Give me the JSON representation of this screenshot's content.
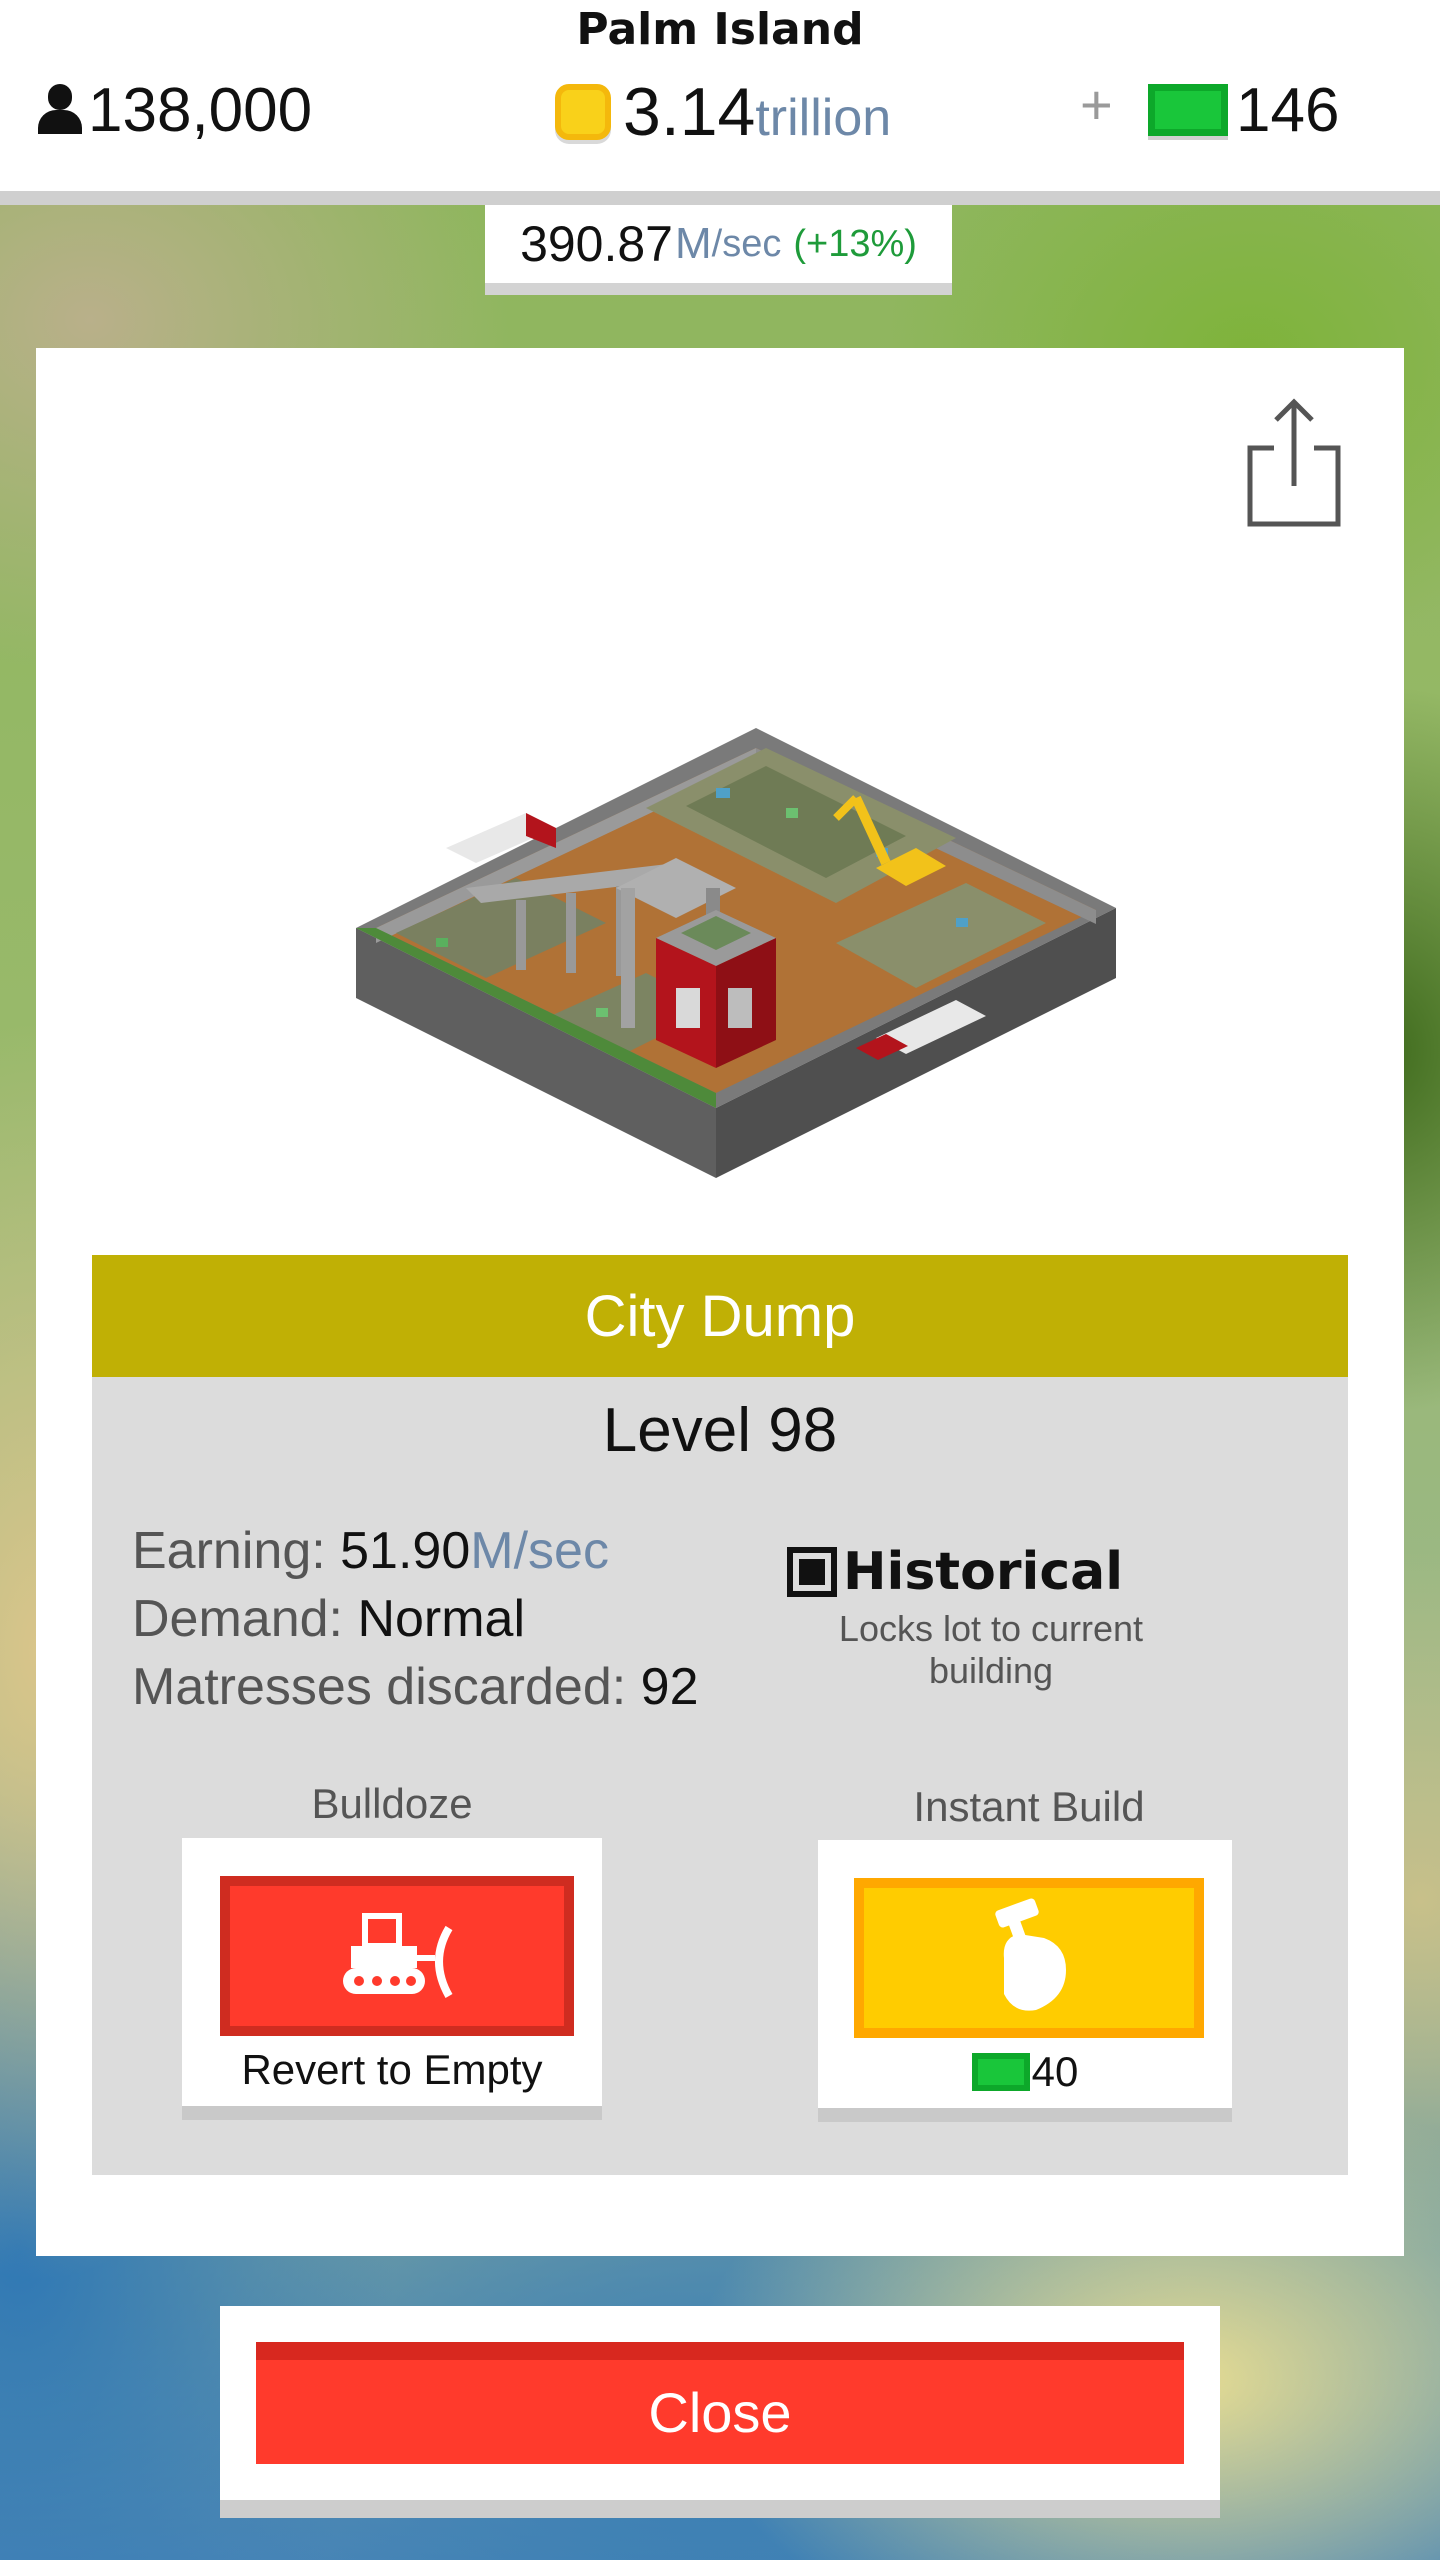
{
  "hud": {
    "island_name": "Palm Island",
    "population": "138,000",
    "coins_value": "3.14",
    "coins_unit": "trillion",
    "plus": "+",
    "bux_value": "146",
    "rate_value": "390.87",
    "rate_unit": "M",
    "rate_per": "/sec",
    "rate_percent": "(+13%)"
  },
  "building": {
    "name": "City Dump",
    "level": "Level 98",
    "earning_label": "Earning: ",
    "earning_value": "51.90",
    "earning_unit": "M/sec",
    "demand_label": "Demand: ",
    "demand_value": "Normal",
    "stat_label": "Matresses discarded: ",
    "stat_value": "92",
    "historical_label": "Historical",
    "historical_desc": "Locks lot to current building",
    "historical_checked": true
  },
  "actions": {
    "bulldoze_label": "Bulldoze",
    "bulldoze_button": "Revert to Empty",
    "instant_label": "Instant Build",
    "instant_cost": "40"
  },
  "close_label": "Close",
  "icons": {
    "population": "person-icon",
    "coins": "coin-icon",
    "bux": "cash-icon",
    "share": "share-icon",
    "bulldoze": "bulldozer-icon",
    "instant": "hammer-hand-icon",
    "historical": "checkbox-icon"
  },
  "colors": {
    "name_bar": "#c0b005",
    "bulldoze": "#ff3a2c",
    "instant": "#ffcc00",
    "close": "#ff3a2c",
    "cash": "#19c63a",
    "unit_text": "#6d88a8",
    "percent_text": "#1e9b3a"
  }
}
